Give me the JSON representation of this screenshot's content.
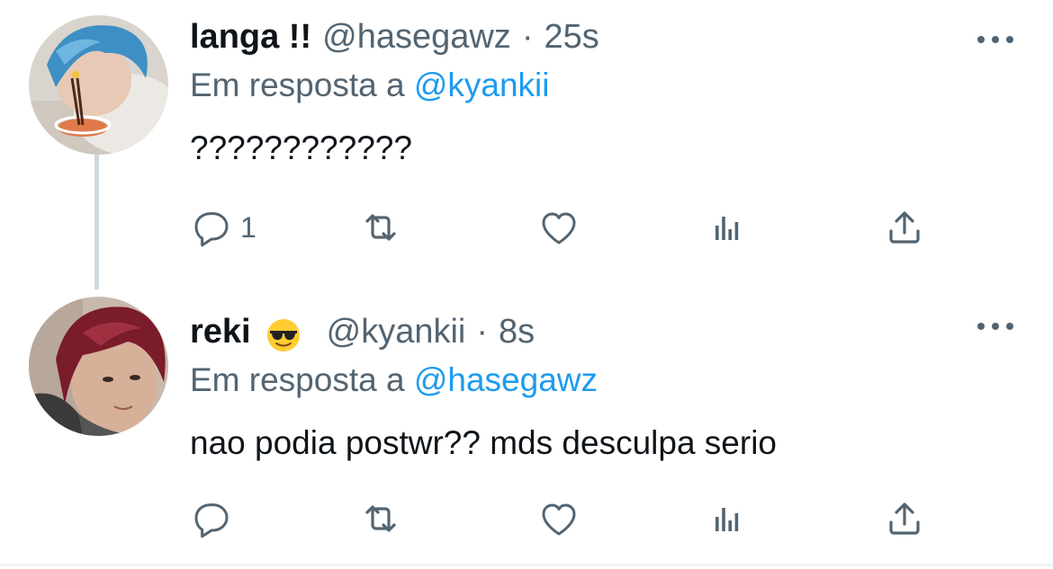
{
  "tweets": [
    {
      "display_name": "langa !!",
      "handle": "@hasegawz",
      "separator": "·",
      "time": "25s",
      "reply_prefix": "Em resposta a",
      "reply_to": "@kyankii",
      "text": "????????????",
      "reply_count": "1",
      "avatar_hair": "#3d8fc4",
      "icons": [
        "reply-icon",
        "retweet-icon",
        "like-icon",
        "views-icon",
        "share-icon"
      ]
    },
    {
      "display_name": "reki",
      "emoji": "smiling-face-with-sunglasses",
      "handle": "@kyankii",
      "separator": "·",
      "time": "8s",
      "reply_prefix": "Em resposta a",
      "reply_to": "@hasegawz",
      "text": "nao podia postwr?? mds desculpa serio",
      "reply_count": "",
      "avatar_hair": "#7a1c2a",
      "icons": [
        "reply-icon",
        "retweet-icon",
        "like-icon",
        "views-icon",
        "share-icon"
      ]
    }
  ],
  "colors": {
    "text": "#0f1419",
    "secondary": "#536471",
    "accent": "#1d9bf0",
    "thread_line": "#cfd9de"
  }
}
